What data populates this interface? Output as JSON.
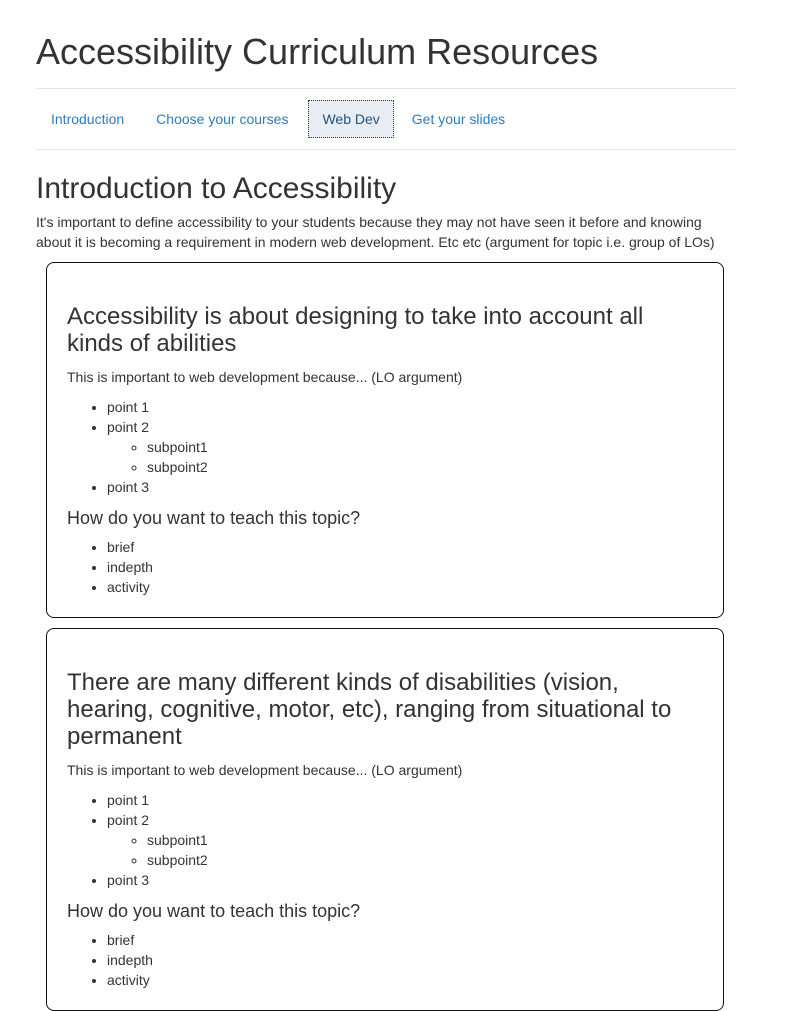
{
  "site": {
    "title": "Accessibility Curriculum Resources"
  },
  "nav": {
    "tabs": [
      {
        "label": "Introduction"
      },
      {
        "label": "Choose your courses"
      },
      {
        "label": "Web Dev"
      },
      {
        "label": "Get your slides"
      }
    ],
    "active_tab": "Web Dev"
  },
  "section": {
    "title": "Introduction to Accessibility",
    "intro": "It's important to define accessibility to your students because they may not have seen it before and knowing about it is becoming a requirement in modern web development. Etc etc (argument for topic i.e. group of LOs)"
  },
  "cards": [
    {
      "title": "Accessibility is about designing to take into account all kinds of abilities",
      "argument": "This is important to web development because... (LO argument)",
      "points": {
        "p1": "point 1",
        "p2": "point 2",
        "sub1": "subpoint1",
        "sub2": "subpoint2",
        "p3": "point 3"
      },
      "teach_question": "How do you want to teach this topic?",
      "teach_options": [
        "brief",
        "indepth",
        "activity"
      ]
    },
    {
      "title": "There are many different kinds of disabilities (vision, hearing, cognitive, motor, etc), ranging from situational to permanent",
      "argument": "This is important to web development because... (LO argument)",
      "points": {
        "p1": "point 1",
        "p2": "point 2",
        "sub1": "subpoint1",
        "sub2": "subpoint2",
        "p3": "point 3"
      },
      "teach_question": "How do you want to teach this topic?",
      "teach_options": [
        "brief",
        "indepth",
        "activity"
      ]
    }
  ]
}
